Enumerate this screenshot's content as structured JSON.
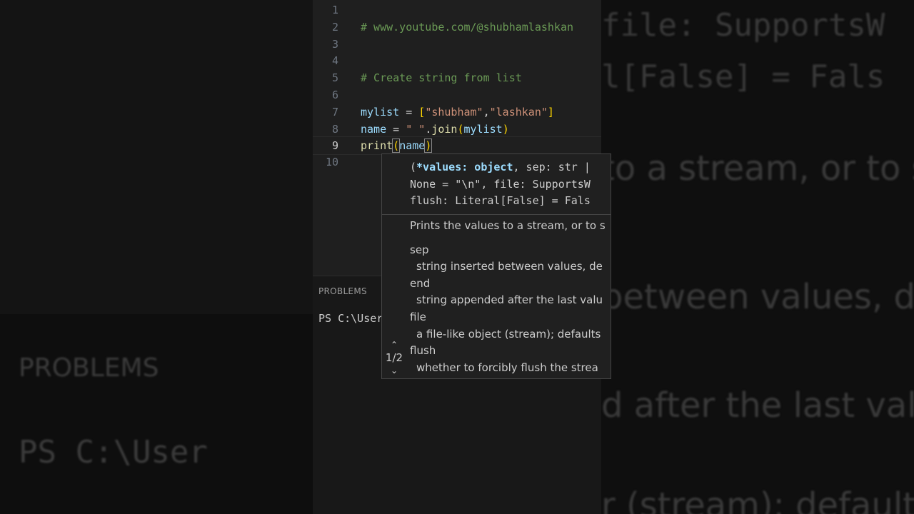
{
  "editor": {
    "lines": [
      {
        "num": "1",
        "text": ""
      },
      {
        "num": "2",
        "text": "# www.youtube.com/@shubhamlashkan"
      },
      {
        "num": "3",
        "text": ""
      },
      {
        "num": "4",
        "text": ""
      },
      {
        "num": "5",
        "text": "# Create string from list"
      },
      {
        "num": "6",
        "text": ""
      },
      {
        "num": "7",
        "text": "mylist = [\"shubham\",\"lashkan\"]"
      },
      {
        "num": "8",
        "text": "name = \" \".join(mylist)"
      },
      {
        "num": "9",
        "text": "print(name)"
      },
      {
        "num": "10",
        "text": ""
      }
    ],
    "tokens": {
      "l7_var": "mylist",
      "l7_eq": " = ",
      "l7_open": "[",
      "l7_s1": "\"shubham\"",
      "l7_comma": ",",
      "l7_s2": "\"lashkan\"",
      "l7_close": "]",
      "l8_var": "name",
      "l8_eq": " = ",
      "l8_str": "\" \"",
      "l8_dot": ".",
      "l8_fn": "join",
      "l8_open": "(",
      "l8_arg": "mylist",
      "l8_close": ")",
      "l9_fn": "print",
      "l9_open": "(",
      "l9_arg": "name",
      "l9_close": ")"
    }
  },
  "panel": {
    "tab_label": "PROBLEMS",
    "terminal_text": "PS C:\\Users"
  },
  "hover": {
    "signature_line1_prefix": "(",
    "signature_param": "*values: object",
    "signature_line1_rest": ", sep: str |",
    "signature_line2": "None = \"\\n\", file: SupportsW",
    "signature_line3": "flush: Literal[False] = Fals",
    "description": "Prints the values to a stream, or to s",
    "params": [
      {
        "name": "sep",
        "desc": "string inserted between values, de"
      },
      {
        "name": "end",
        "desc": "string appended after the last valu"
      },
      {
        "name": "file",
        "desc": "a file-like object (stream); defaults"
      },
      {
        "name": "flush",
        "desc": "whether to forcibly flush the strea"
      }
    ],
    "overload_counter": "1/2"
  },
  "background": {
    "left_problems": "PROBLEMS",
    "left_terminal": "PS C:\\User",
    "right_line1": "file: SupportsW",
    "right_line2": "l[False] = Fals",
    "right_line3": "to a stream, or to s",
    "right_line4": "between values, de",
    "right_line5": "d after the last valu",
    "right_line6": "r (stream); defaults"
  }
}
